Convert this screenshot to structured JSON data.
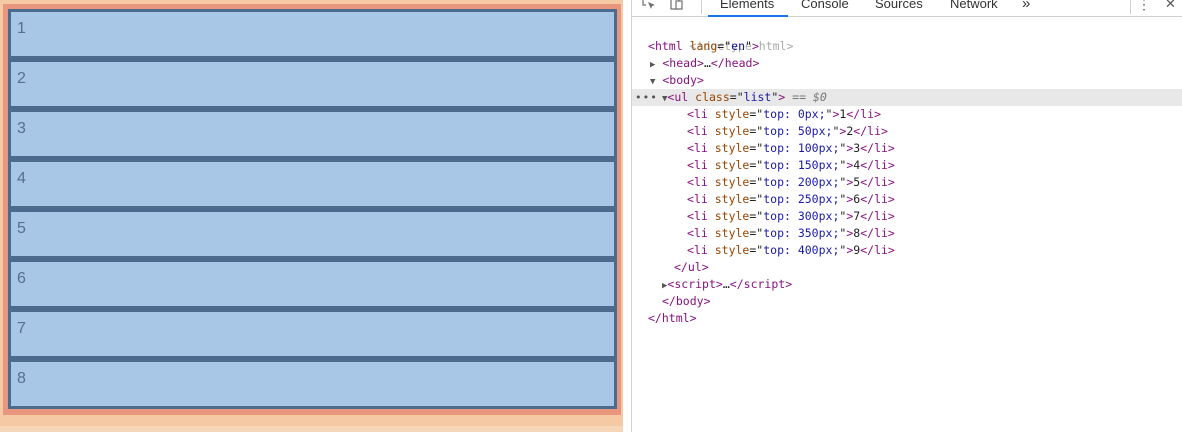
{
  "page": {
    "items": [
      "1",
      "2",
      "3",
      "4",
      "5",
      "6",
      "7",
      "8"
    ]
  },
  "devtools": {
    "tabs": [
      "Elements",
      "Console",
      "Sources",
      "Network"
    ],
    "overflow": "»",
    "menu": "⋮",
    "close": "✕",
    "dom": {
      "doctype": "<!doctype html>",
      "html_open": "html",
      "html_attr": "lang",
      "html_val": "en",
      "head": "head",
      "head_ellipsis": "…",
      "body": "body",
      "ul": "ul",
      "ul_attr": "class",
      "ul_val": "list",
      "selected_marker": "== $0",
      "li_items": [
        {
          "style": "top: 0px;",
          "text": "1"
        },
        {
          "style": "top: 50px;",
          "text": "2"
        },
        {
          "style": "top: 100px;",
          "text": "3"
        },
        {
          "style": "top: 150px;",
          "text": "4"
        },
        {
          "style": "top: 200px;",
          "text": "5"
        },
        {
          "style": "top: 250px;",
          "text": "6"
        },
        {
          "style": "top: 300px;",
          "text": "7"
        },
        {
          "style": "top: 350px;",
          "text": "8"
        },
        {
          "style": "top: 400px;",
          "text": "9"
        }
      ],
      "script": "script",
      "script_ellipsis": "…"
    }
  },
  "colors": {
    "item_bg": "#a8c6e6",
    "item_border": "#4c6a8c",
    "list_bg": "#e8967d",
    "page_bg": "#f4c9a4",
    "tab_accent": "#1a73e8"
  }
}
